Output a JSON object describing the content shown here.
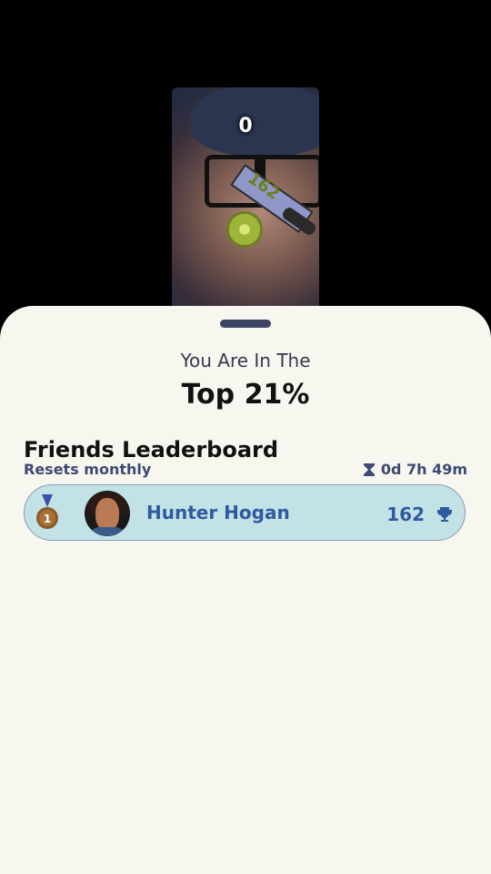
{
  "game": {
    "current_score": "0",
    "knife_label": "162"
  },
  "results": {
    "intro": "You Are In The",
    "rank": "Top 21%"
  },
  "leaderboard": {
    "title": "Friends Leaderboard",
    "subtitle": "Resets monthly",
    "timer": "0d 7h 49m",
    "entries": [
      {
        "rank": "1",
        "name": "Hunter Hogan",
        "score": "162"
      }
    ]
  },
  "colors": {
    "sheet_bg": "#f7f7ef",
    "row_bg": "#c3e2e5",
    "accent": "#2e5a9f",
    "handle": "#3d4566"
  },
  "icons": [
    "hourglass-icon",
    "medal-icon",
    "trophy-icon"
  ]
}
